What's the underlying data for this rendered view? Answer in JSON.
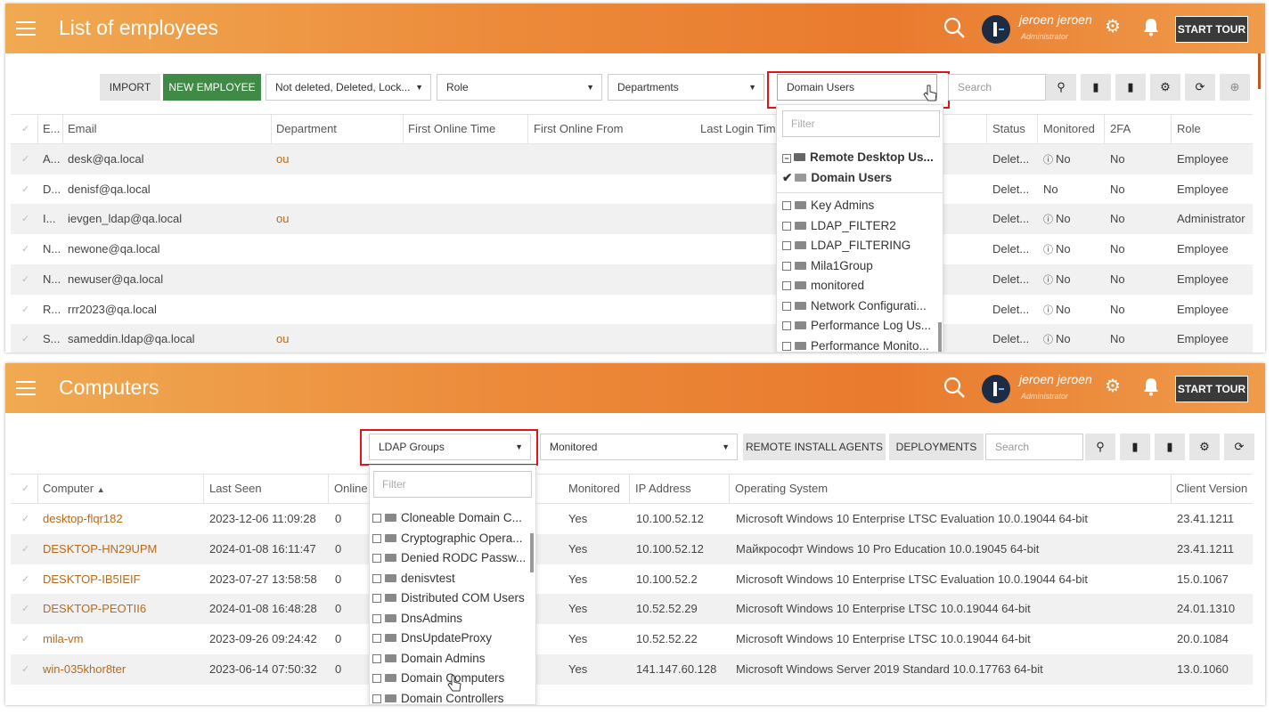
{
  "employees": {
    "title": "List of employees",
    "user": {
      "name": "jeroen jeroen",
      "role": "Administrator"
    },
    "tour": "START TOUR",
    "import": "IMPORT",
    "new_employee": "NEW EMPLOYEE",
    "status_filter": "Not deleted, Deleted, Lock...",
    "role_filter": "Role",
    "dept_filter": "Departments",
    "group_filter": "Domain Users",
    "search_placeholder": "Search",
    "columns": [
      "E...",
      "Email",
      "Department",
      "First Online Time",
      "First Online From",
      "Last Login Time",
      "Status",
      "Monitored",
      "2FA",
      "Role"
    ],
    "rows": [
      {
        "e": "A...",
        "email": "desk@qa.local",
        "dept": "ou",
        "status": "Delet...",
        "mon": "No",
        "mon_icon": true,
        "fa": "No",
        "role": "Employee"
      },
      {
        "e": "D...",
        "email": "denisf@qa.local",
        "dept": "",
        "status": "Delet...",
        "mon": "No",
        "mon_icon": false,
        "fa": "No",
        "role": "Employee"
      },
      {
        "e": "I...",
        "email": "ievgen_ldap@qa.local",
        "dept": "ou",
        "status": "Delet...",
        "mon": "No",
        "mon_icon": true,
        "fa": "No",
        "role": "Administrator"
      },
      {
        "e": "N...",
        "email": "newone@qa.local",
        "dept": "",
        "status": "Delet...",
        "mon": "No",
        "mon_icon": true,
        "fa": "No",
        "role": "Employee"
      },
      {
        "e": "N...",
        "email": "newuser@qa.local",
        "dept": "",
        "status": "Delet...",
        "mon": "No",
        "mon_icon": true,
        "fa": "No",
        "role": "Employee"
      },
      {
        "e": "R...",
        "email": "rrr2023@qa.local",
        "dept": "",
        "status": "Delet...",
        "mon": "No",
        "mon_icon": true,
        "fa": "No",
        "role": "Employee"
      },
      {
        "e": "S...",
        "email": "sameddin.ldap@qa.local",
        "dept": "ou",
        "status": "Delet...",
        "mon": "No",
        "mon_icon": true,
        "fa": "No",
        "role": "Employee"
      }
    ],
    "dropdown": {
      "filter_placeholder": "Filter",
      "parent": "Remote Desktop Us...",
      "selected": "Domain Users",
      "items": [
        "Key Admins",
        "LDAP_FILTER2",
        "LDAP_FILTERING",
        "Mila1Group",
        "monitored",
        "Network Configurati...",
        "Performance Log Us...",
        "Performance Monito..."
      ]
    }
  },
  "computers": {
    "title": "Computers",
    "user": {
      "name": "jeroen jeroen",
      "role": "Administrator"
    },
    "tour": "START TOUR",
    "ldap_filter": "LDAP Groups",
    "monitored_filter": "Monitored",
    "remote_install": "REMOTE INSTALL AGENTS",
    "deployments": "DEPLOYMENTS",
    "search_placeholder": "Search",
    "columns": [
      "Computer",
      "Last Seen",
      "Online",
      "Monitored",
      "IP Address",
      "Operating System",
      "Client Version"
    ],
    "rows": [
      {
        "name": "desktop-flqr182",
        "seen": "2023-12-06 11:09:28",
        "online": "0",
        "mon": "Yes",
        "ip": "10.100.52.12",
        "os": "Microsoft Windows 10 Enterprise LTSC Evaluation 10.0.19044 64-bit",
        "ver": "23.41.1211"
      },
      {
        "name": "DESKTOP-HN29UPM",
        "seen": "2024-01-08 16:11:47",
        "online": "0",
        "mon": "Yes",
        "ip": "10.100.52.12",
        "os": "Майкрософт Windows 10 Pro Education 10.0.19045 64-bit",
        "ver": "23.41.1211"
      },
      {
        "name": "DESKTOP-IB5IEIF",
        "seen": "2023-07-27 13:58:58",
        "online": "0",
        "mon": "Yes",
        "ip": "10.100.52.2",
        "os": "Microsoft Windows 10 Enterprise LTSC Evaluation 10.0.19044 64-bit",
        "ver": "15.0.1067"
      },
      {
        "name": "DESKTOP-PEOTII6",
        "seen": "2024-01-08 16:48:28",
        "online": "0",
        "mon": "Yes",
        "ip": "10.52.52.29",
        "os": "Microsoft Windows 10 Enterprise LTSC 10.0.19044 64-bit",
        "ver": "24.01.1310"
      },
      {
        "name": "mila-vm",
        "seen": "2023-09-26 09:24:42",
        "online": "0",
        "mon": "Yes",
        "ip": "10.52.52.22",
        "os": "Microsoft Windows 10 Enterprise LTSC 10.0.19044 64-bit",
        "ver": "20.0.1084"
      },
      {
        "name": "win-035khor8ter",
        "seen": "2023-06-14 07:50:32",
        "online": "0",
        "mon": "Yes",
        "ip": "141.147.60.128",
        "os": "Microsoft Windows Server 2019 Standard 10.0.17763 64-bit",
        "ver": "13.0.1060"
      }
    ],
    "dropdown": {
      "filter_placeholder": "Filter",
      "items": [
        "Cloneable Domain C...",
        "Cryptographic Opera...",
        "Denied RODC Passw...",
        "denisvtest",
        "Distributed COM Users",
        "DnsAdmins",
        "DnsUpdateProxy",
        "Domain Admins",
        "Domain Computers",
        "Domain Controllers"
      ]
    }
  },
  "colors": {
    "accent": "#ec8a3a",
    "green": "#3f8a45",
    "highlight": "#e0151b",
    "link": "#b86a1a"
  }
}
